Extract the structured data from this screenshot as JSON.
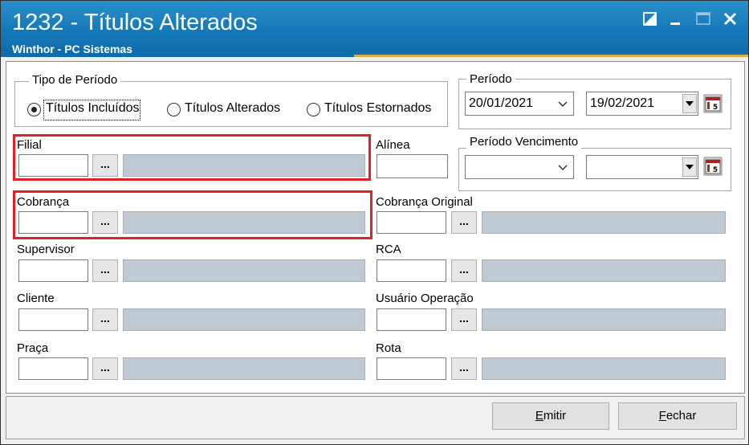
{
  "window": {
    "title": "1232 - Títulos Alterados",
    "subtitle": "Winthor - PC Sistemas",
    "title_bar_color": "#1478b8",
    "accent_color": "#d7b04a",
    "controls": [
      "restore-icon",
      "minimize-icon",
      "maximize-icon",
      "close-icon"
    ]
  },
  "tipo_periodo": {
    "legend": "Tipo de Período",
    "options": [
      {
        "label": "Títulos Incluídos",
        "selected": true
      },
      {
        "label": "Títulos Alterados",
        "selected": false
      },
      {
        "label": "Títulos Estornados",
        "selected": false
      }
    ]
  },
  "periodo": {
    "legend": "Período",
    "start": "20/01/2021",
    "end": "19/02/2021"
  },
  "periodo_vencimento": {
    "legend": "Período Vencimento",
    "start": "",
    "end": ""
  },
  "fields": {
    "filial": {
      "label": "Filial",
      "code": "",
      "description": ""
    },
    "alinea": {
      "label": "Alínea",
      "value": ""
    },
    "cobranca": {
      "label": "Cobrança",
      "code": "",
      "description": ""
    },
    "cobranca_original": {
      "label": "Cobrança Original",
      "code": "",
      "description": ""
    },
    "supervisor": {
      "label": "Supervisor",
      "code": "",
      "description": ""
    },
    "rca": {
      "label": "RCA",
      "code": "",
      "description": ""
    },
    "cliente": {
      "label": "Cliente",
      "code": "",
      "description": ""
    },
    "usuario_operacao": {
      "label": "Usuário Operação",
      "code": "",
      "description": ""
    },
    "praca": {
      "label": "Praça",
      "code": "",
      "description": ""
    },
    "rota": {
      "label": "Rota",
      "code": "",
      "description": ""
    }
  },
  "ellipsis_label": "...",
  "highlight_color": "#e0202a",
  "buttons": {
    "emitir": {
      "label": "Emitir",
      "mnemonic": "E",
      "rest": "mitir"
    },
    "fechar": {
      "label": "Fechar",
      "mnemonic": "F",
      "rest": "echar"
    }
  }
}
